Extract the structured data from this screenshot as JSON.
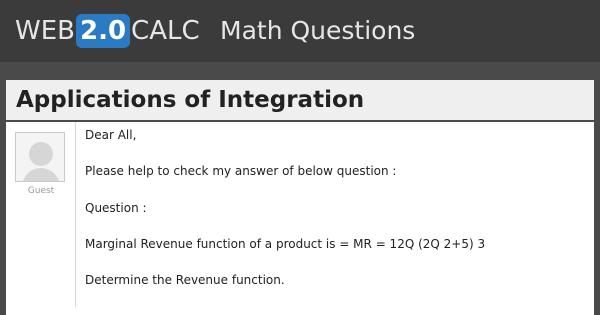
{
  "header": {
    "logo": {
      "prefix": "WEB",
      "badge": "2.0",
      "suffix": "CALC"
    },
    "section": "Math Questions"
  },
  "title": "Applications of Integration",
  "post": {
    "author": "Guest",
    "lines": [
      "Dear All,",
      "Please help to check my answer of below question :",
      "Question :",
      "Marginal Revenue function of a product is = MR = 12Q (2Q 2+5) 3",
      "Determine the Revenue function."
    ]
  },
  "colors": {
    "background": "#4a4a4a",
    "header": "#3b3b3b",
    "badge": "#2a7bc4",
    "title_bar": "#efefef"
  },
  "icons": {
    "avatar": "user-silhouette-icon"
  }
}
